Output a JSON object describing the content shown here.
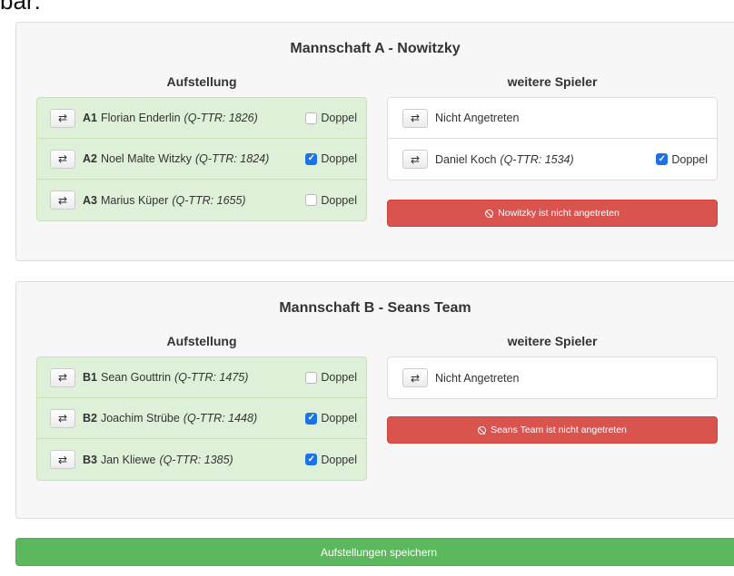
{
  "top_crop_text": "bar:",
  "icons": {
    "swap": "⇄",
    "check": "✓",
    "ban": "ban-icon"
  },
  "teams": [
    {
      "title": "Mannschaft A - Nowitzky",
      "lineup_title": "Aufstellung",
      "others_title": "weitere Spieler",
      "lineup": [
        {
          "pos": "A1",
          "name": "Florian Enderlin",
          "ttr": "(Q-TTR: 1826)",
          "doppel_label": "Doppel",
          "doppel_checked": false
        },
        {
          "pos": "A2",
          "name": "Noel Malte Witzky",
          "ttr": "(Q-TTR: 1824)",
          "doppel_label": "Doppel",
          "doppel_checked": true
        },
        {
          "pos": "A3",
          "name": "Marius Küper",
          "ttr": "(Q-TTR: 1655)",
          "doppel_label": "Doppel",
          "doppel_checked": false
        }
      ],
      "others": [
        {
          "name": "Nicht Angetreten",
          "ttr": "",
          "doppel_label": "",
          "doppel_checked": false
        },
        {
          "name": "Daniel Koch",
          "ttr": "(Q-TTR: 1534)",
          "doppel_label": "Doppel",
          "doppel_checked": true
        }
      ],
      "not_played_label": "Nowitzky ist nicht angetreten"
    },
    {
      "title": "Mannschaft B - Seans Team",
      "lineup_title": "Aufstellung",
      "others_title": "weitere Spieler",
      "lineup": [
        {
          "pos": "B1",
          "name": "Sean Gouttrin",
          "ttr": "(Q-TTR: 1475)",
          "doppel_label": "Doppel",
          "doppel_checked": false
        },
        {
          "pos": "B2",
          "name": "Joachim Strübe",
          "ttr": "(Q-TTR: 1448)",
          "doppel_label": "Doppel",
          "doppel_checked": true
        },
        {
          "pos": "B3",
          "name": "Jan Kliewe",
          "ttr": "(Q-TTR: 1385)",
          "doppel_label": "Doppel",
          "doppel_checked": true
        }
      ],
      "others": [
        {
          "name": "Nicht Angetreten",
          "ttr": "",
          "doppel_label": "",
          "doppel_checked": false
        }
      ],
      "not_played_label": "Seans Team ist nicht angetreten"
    }
  ],
  "save_label": "Aufstellungen speichern",
  "colors": {
    "lineup_bg": "#dff0d8",
    "danger": "#d9534f",
    "success": "#5cb85c",
    "checkbox": "#1a73e8"
  }
}
